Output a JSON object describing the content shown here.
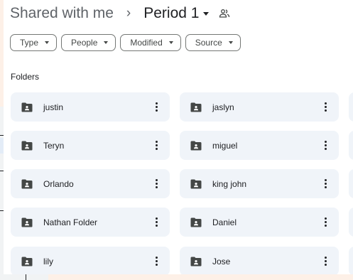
{
  "breadcrumb": {
    "root": "Shared with me",
    "separator": "›",
    "current": "Period 1"
  },
  "filters": [
    {
      "label": "Type"
    },
    {
      "label": "People"
    },
    {
      "label": "Modified"
    },
    {
      "label": "Source"
    }
  ],
  "section": {
    "title": "Folders"
  },
  "folders": [
    {
      "name": "justin"
    },
    {
      "name": "jaslyn"
    },
    {
      "name": "Teryn"
    },
    {
      "name": "miguel"
    },
    {
      "name": "Orlando"
    },
    {
      "name": "king john"
    },
    {
      "name": "Nathan Folder"
    },
    {
      "name": "Daniel"
    },
    {
      "name": "lily"
    },
    {
      "name": "Jose"
    }
  ],
  "colors": {
    "card_bg": "#f0f4f9",
    "page_bg": "#fdf0e7",
    "icon": "#444746"
  },
  "icons": {
    "folder": "shared-folder-icon",
    "share": "people-icon",
    "more": "more-vert-icon"
  }
}
